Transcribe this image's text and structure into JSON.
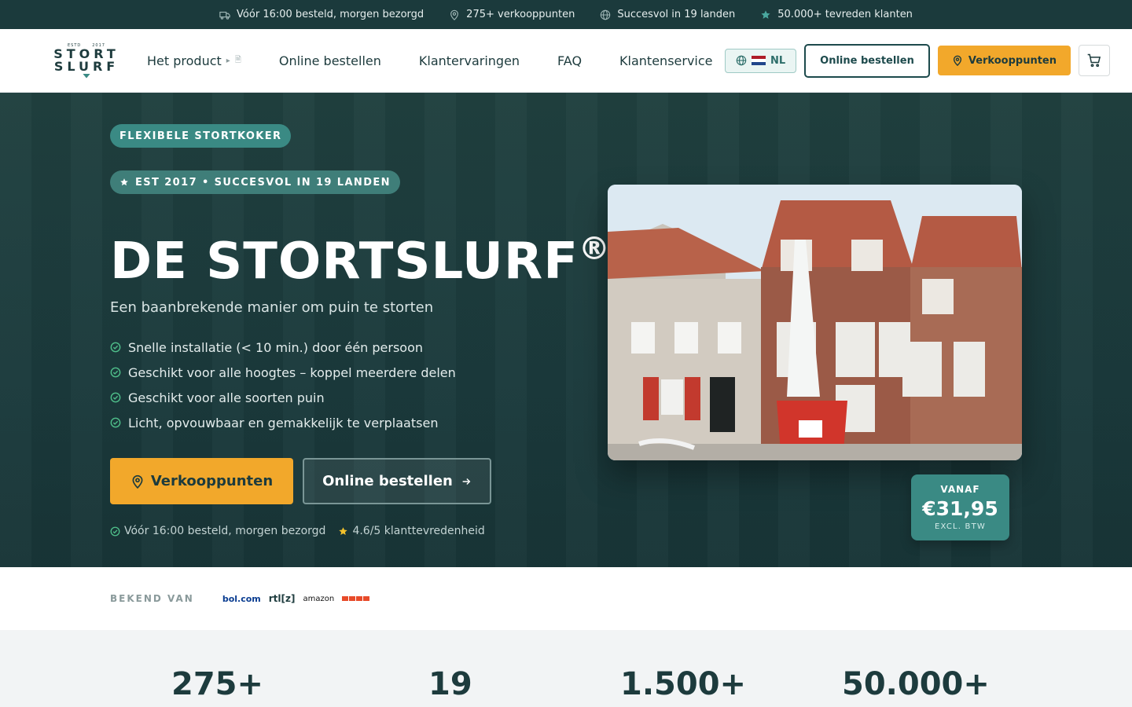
{
  "topbar": {
    "items": [
      {
        "icon": "truck-icon",
        "text": "Vóór 16:00 besteld, morgen bezorgd"
      },
      {
        "icon": "map-pin-icon",
        "text": "275+ verkooppunten"
      },
      {
        "icon": "globe-icon",
        "text": "Succesvol in 19 landen"
      },
      {
        "icon": "star-icon",
        "text": "50.000+ tevreden klanten"
      }
    ]
  },
  "logo": {
    "estd_left": "ESTD",
    "estd_right": "2017",
    "line1": "STORT",
    "line2": "SLURF"
  },
  "nav": {
    "items": [
      "Het product",
      "Online bestellen",
      "Klantervaringen",
      "FAQ",
      "Klantenservice"
    ],
    "product_caret": "▸",
    "product_doc": "🗎"
  },
  "header": {
    "lang": "NL",
    "online_button": "Online bestellen",
    "sales_button": "Verkooppunten"
  },
  "hero": {
    "pill1": "FLEXIBELE STORTKOKER",
    "pill2": "EST 2017 • SUCCESVOL IN 19 LANDEN",
    "title": "DE STORTSLURF",
    "title_mark": "®",
    "subtitle": "Een baanbrekende manier om puin te storten",
    "features": [
      "Snelle installatie (< 10 min.) door één persoon",
      "Geschikt voor alle hoogtes – koppel meerdere delen",
      "Geschikt voor alle soorten puin",
      "Licht, opvouwbaar en gemakkelijk te verplaatsen"
    ],
    "cta_primary": "Verkooppunten",
    "cta_secondary": "Online bestellen",
    "meta_delivery": "Vóór 16:00 besteld, morgen bezorgd",
    "meta_rating": "4.6/5 klanttevredenheid"
  },
  "price_badge": {
    "label": "VANAF",
    "price": "€31,95",
    "note": "EXCL. BTW"
  },
  "known": {
    "label": "BEKEND VAN",
    "brands": [
      "bol.com",
      "rtl[z]",
      "amazon",
      "RTL4"
    ]
  },
  "stats": [
    "275+",
    "19",
    "1.500+",
    "50.000+"
  ],
  "colors": {
    "dark_teal": "#1b3a3c",
    "teal": "#3a8a84",
    "orange": "#f2a82b"
  }
}
